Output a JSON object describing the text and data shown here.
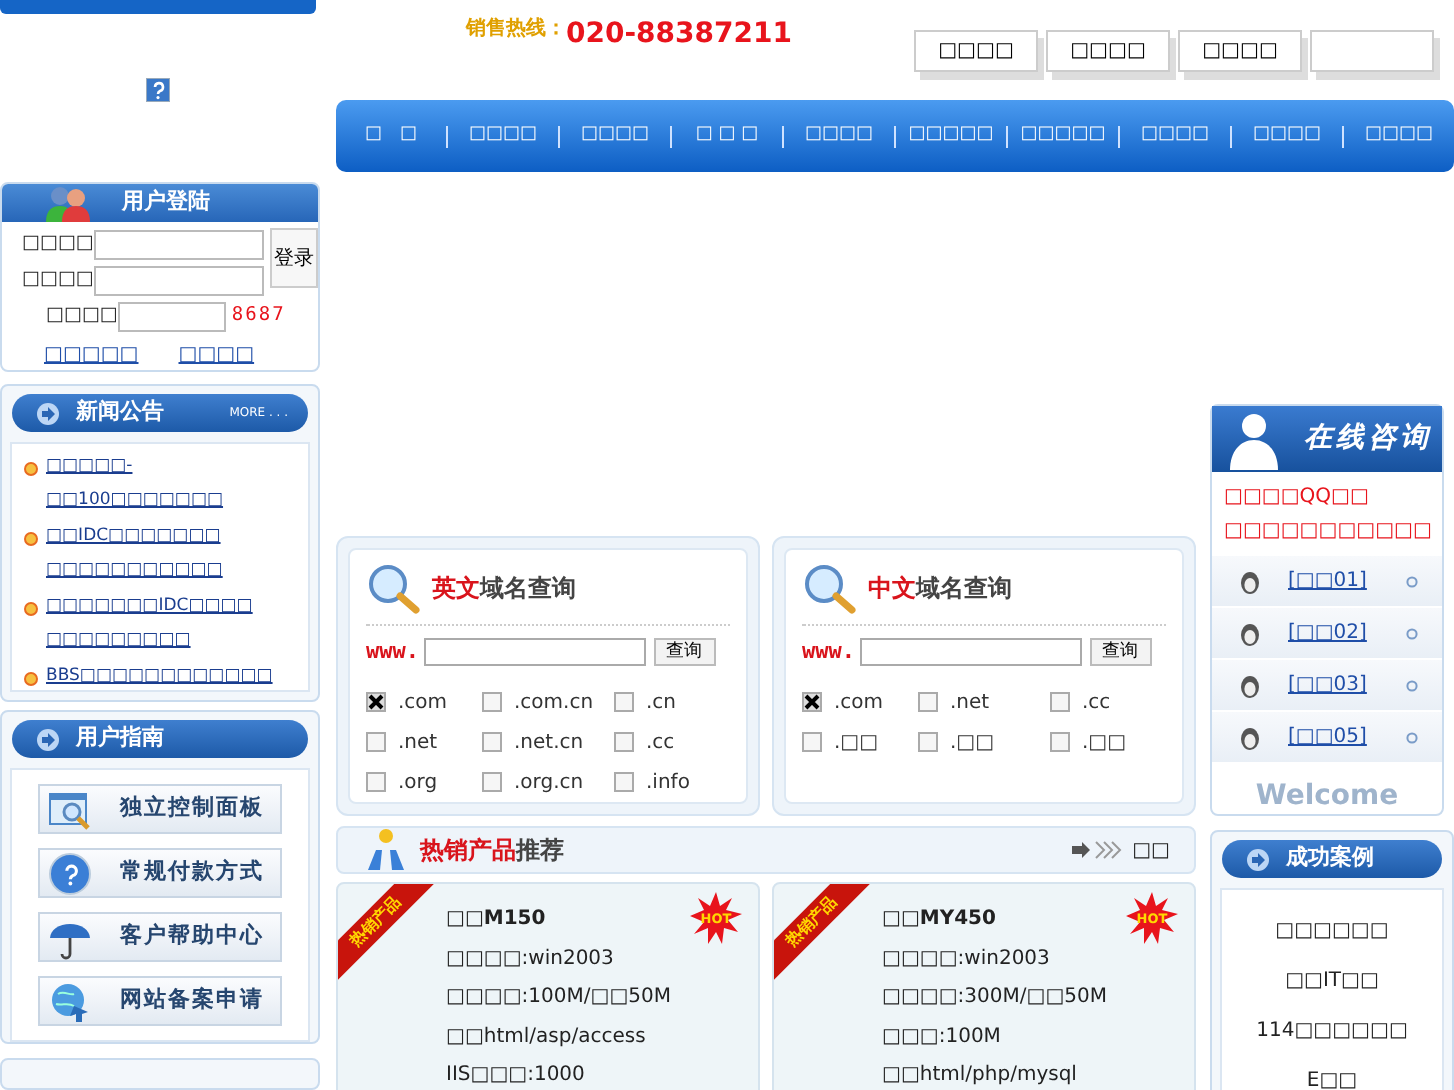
{
  "hotline": {
    "label": "销售热线：",
    "number": "020-88387211"
  },
  "top_links": [
    "□□□□",
    "□□□□",
    "□□□□"
  ],
  "nav": [
    "□　□",
    "□□□□",
    "□□□□",
    "□ □ □",
    "□□□□",
    "□□□□□",
    "□□□□□",
    "□□□□",
    "□□□□",
    "□□□□"
  ],
  "login": {
    "title": "用户登陆",
    "fields": [
      {
        "label": "□□□□"
      },
      {
        "label": "□□□□"
      }
    ],
    "captcha_label": "□□□□",
    "captcha": "8687",
    "button": "登录",
    "links": [
      "□□□□□",
      "□□□□"
    ]
  },
  "news": {
    "title": "新闻公告",
    "more": "MORE . . .",
    "items": [
      "□□□□□-□□100□□□□□□□",
      "□□IDC□□□□□□□ □□□□□□□□□□□",
      "□□□□□□□IDC□□□□ □□□□□□□□□",
      "BBS□□□□□□□□□□□□"
    ]
  },
  "guide": {
    "title": "用户指南",
    "items": [
      {
        "label": "独立控制面板",
        "kind": "panel"
      },
      {
        "label": "常规付款方式",
        "kind": "help"
      },
      {
        "label": "客户帮助中心",
        "kind": "umbrella"
      },
      {
        "label": "网站备案申请",
        "kind": "globe"
      }
    ]
  },
  "domain_search": [
    {
      "title_highlight": "英文",
      "title_rest": "域名查询",
      "prefix": "www.",
      "button": "查询",
      "options": [
        {
          "label": ".com",
          "checked": true
        },
        {
          "label": ".com.cn",
          "checked": false
        },
        {
          "label": ".cn",
          "checked": false
        },
        {
          "label": ".net",
          "checked": false
        },
        {
          "label": ".net.cn",
          "checked": false
        },
        {
          "label": ".cc",
          "checked": false
        },
        {
          "label": ".org",
          "checked": false
        },
        {
          "label": ".org.cn",
          "checked": false
        },
        {
          "label": ".info",
          "checked": false
        }
      ]
    },
    {
      "title_highlight": "中文",
      "title_rest": "域名查询",
      "prefix": "www.",
      "button": "查询",
      "options": [
        {
          "label": ".com",
          "checked": true
        },
        {
          "label": ".net",
          "checked": false
        },
        {
          "label": ".cc",
          "checked": false
        },
        {
          "label": ".□□",
          "checked": false
        },
        {
          "label": ".□□",
          "checked": false
        },
        {
          "label": ".□□",
          "checked": false
        }
      ]
    }
  ],
  "hot_products": {
    "title_highlight": "热销产品",
    "title_rest": "推荐",
    "more": "□□",
    "products": [
      {
        "ribbon": "热销产品",
        "badge": "HOT",
        "name": "□□M150",
        "specs": [
          "□□□□:win2003",
          "□□□□:100M/□□50M",
          "□□html/asp/access",
          "IIS□□□:1000"
        ]
      },
      {
        "ribbon": "热销产品",
        "badge": "HOT",
        "name": "□□MY450",
        "specs": [
          "□□□□:win2003",
          "□□□□:300M/□□50M",
          "□□□:100M",
          "□□html/php/mysql"
        ]
      }
    ]
  },
  "online": {
    "title": "在线咨询",
    "notes": [
      "□□□□QQ□□",
      "□□□□□□□□□□□"
    ],
    "contacts": [
      "[□□01]",
      "[□□02]",
      "[□□03]",
      "[□□05]"
    ],
    "watermark": "Welcome"
  },
  "cases": {
    "title": "成功案例",
    "items": [
      "□□□□□□",
      "□□IT□□",
      "114□□□□□□",
      "E□□"
    ]
  }
}
